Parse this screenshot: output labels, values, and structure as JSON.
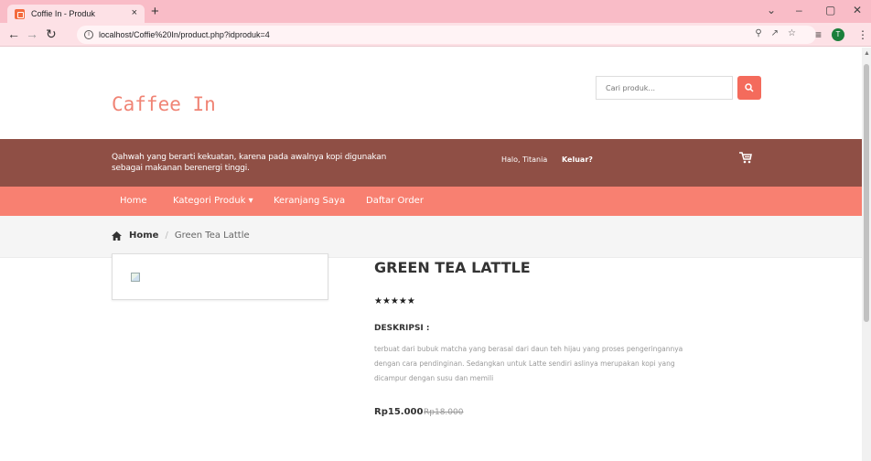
{
  "browser": {
    "tab_title": "Coffie In - Produk",
    "tab_close": "×",
    "new_tab": "+",
    "url": "localhost/Coffie%20In/product.php?idproduk=4",
    "profile_initial": "T",
    "window_controls": {
      "minimize": "–",
      "maximize": "▢",
      "close": "✕",
      "dropdown": "⌄"
    }
  },
  "header": {
    "logo": "Caffee In",
    "search_placeholder": "Cari produk...",
    "tagline": "Qahwah yang berarti kekuatan, karena pada awalnya kopi digunakan sebagai makanan berenergi tinggi.",
    "greeting": "Halo, Titania",
    "logout": "Keluar?"
  },
  "menu": {
    "items": [
      {
        "label": "Home"
      },
      {
        "label": "Kategori Produk ▾"
      },
      {
        "label": "Keranjang Saya"
      },
      {
        "label": "Daftar Order"
      }
    ]
  },
  "breadcrumb": {
    "home": "Home",
    "separator": "/",
    "current": "Green Tea Lattle"
  },
  "product": {
    "title": "GREEN TEA LATTLE",
    "rating": 5,
    "stars": "★★★★★",
    "desc_label": "DESKRIPSI :",
    "description": "terbuat dari bubuk matcha yang berasal dari daun teh hijau yang proses pengeringannya dengan cara pendinginan. Sedangkan untuk Latte sendiri aslinya merupakan kopi yang dicampur dengan susu dan memili",
    "price": "Rp15.000",
    "price_old": "Rp18.000"
  },
  "colors": {
    "tabstrip": "#f9bcc7",
    "topbar": "#8f4f45",
    "menubar": "#f88071",
    "logo": "#f08475",
    "search_button": "#f46b5c"
  },
  "icons": {
    "search": "search-icon",
    "cart": "cart-icon",
    "home": "home-icon",
    "back": "back-arrow-icon",
    "forward": "forward-arrow-icon",
    "reload": "reload-icon",
    "info": "info-icon"
  }
}
